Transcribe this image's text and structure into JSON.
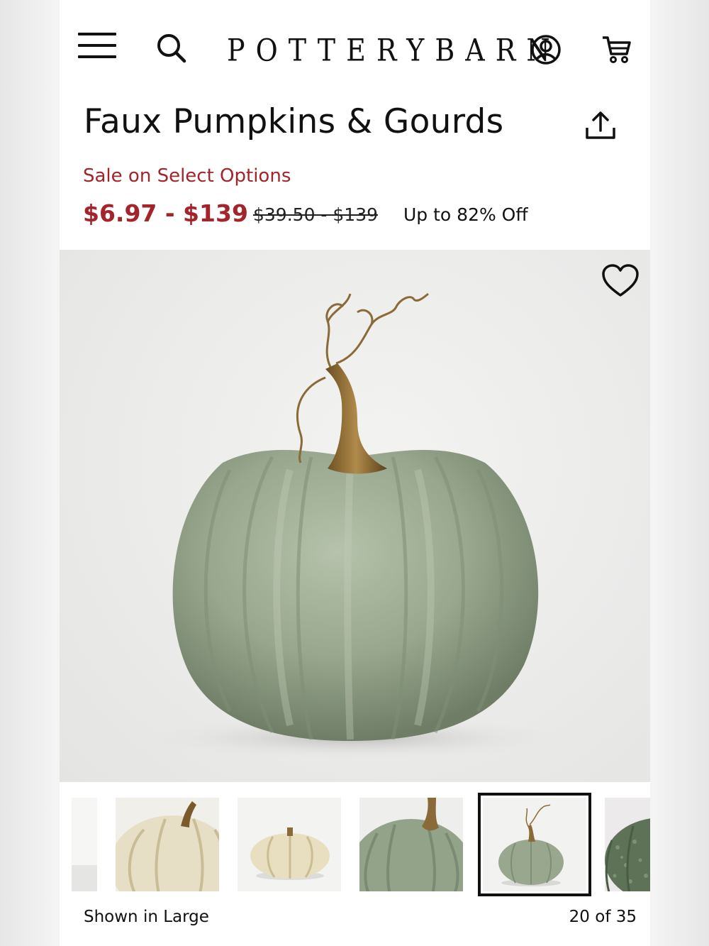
{
  "header": {
    "brand": "POTTERYBARN",
    "menu_icon": "hamburger-menu-icon",
    "search_icon": "search-icon",
    "account_icon": "account-icon",
    "cart_icon": "cart-icon"
  },
  "product": {
    "title": "Faux Pumpkins & Gourds",
    "share_icon": "share-icon",
    "sale_label": "Sale on Select Options",
    "sale_price": "$6.97 - $139",
    "original_price": "$39.50 - $139",
    "discount": "Up to 82% Off",
    "favorite_icon": "heart-icon"
  },
  "gallery": {
    "caption": "Shown in Large",
    "counter": "20 of 35",
    "selected_index": 4
  },
  "colors": {
    "sale_red": "#a3242b",
    "text": "#111111",
    "sage_pumpkin": "#96a68c",
    "cream_pumpkin": "#e6dfc6"
  }
}
